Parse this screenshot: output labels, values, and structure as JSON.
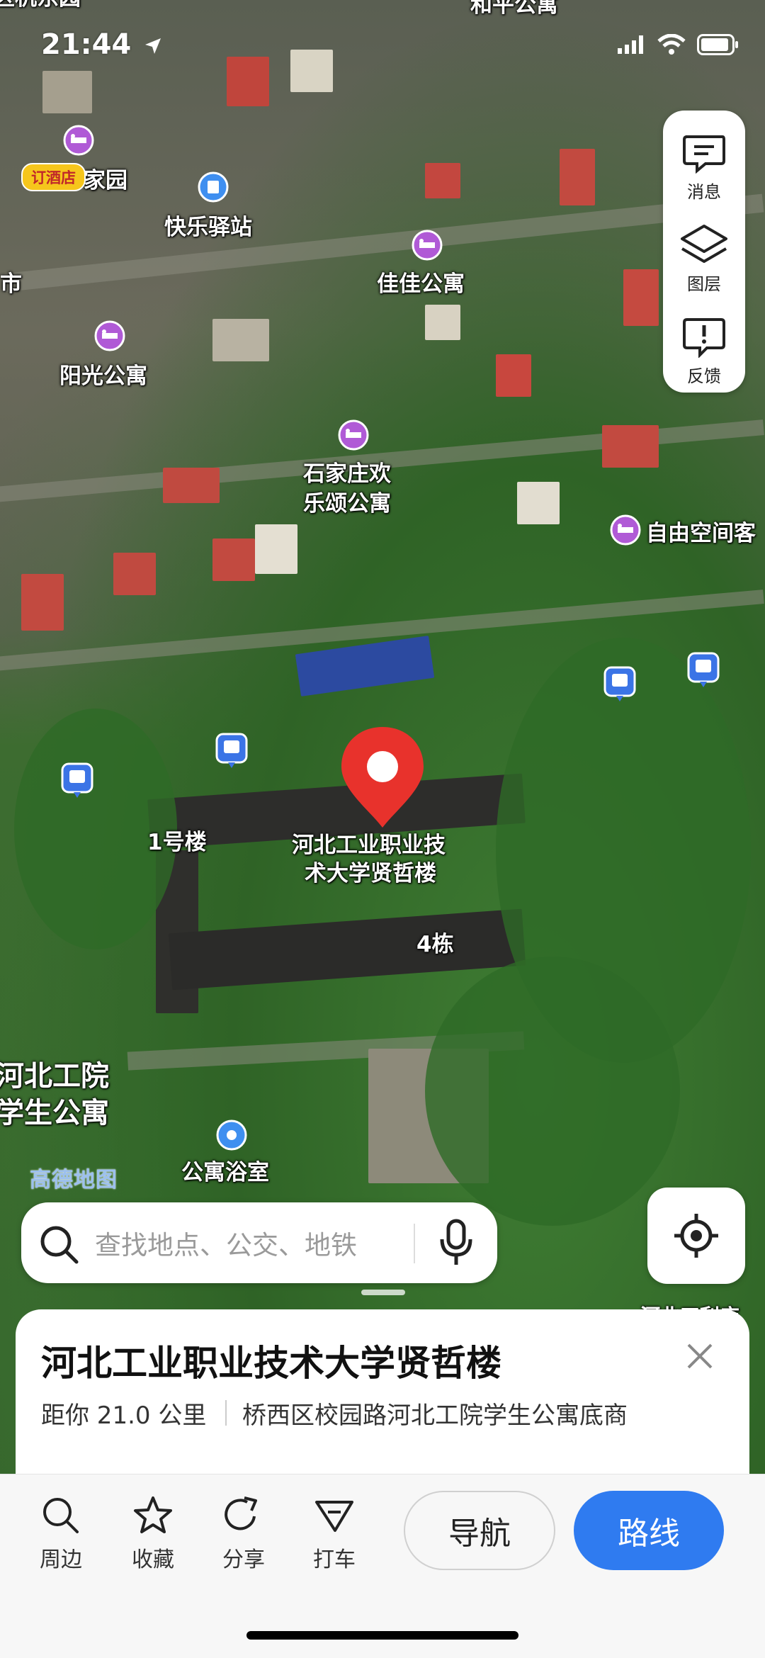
{
  "status_bar": {
    "time": "21:44"
  },
  "side_panel": {
    "items": [
      {
        "label": "消息",
        "icon": "message-icon"
      },
      {
        "label": "图层",
        "icon": "layers-icon"
      },
      {
        "label": "反馈",
        "icon": "feedback-icon"
      }
    ]
  },
  "map": {
    "labels": {
      "top_partial_left": "区机东园",
      "top_partial_right": "和平公寓",
      "left_edge": "市",
      "hotel_garden": "家园",
      "happy_inn": "快乐驿站",
      "jiajia": "佳佳公寓",
      "sunshine": "阳光公寓",
      "shijiazhuang_line1": "石家庄欢",
      "shijiazhuang_line2": "乐颂公寓",
      "freedom": "自由空间客",
      "building1": "1号楼",
      "target_line1": "河北工业职业技",
      "target_line2": "术大学贤哲楼",
      "building4": "4栋",
      "hebei_apt_line1": "河北工院",
      "hebei_apt_line2": "学生公寓",
      "bathhouse": "公寓浴室",
      "bottom_right_partial": "河北工利店"
    },
    "hotel_badge": "订酒店",
    "logo": "高德地图",
    "colors": {
      "pin_red": "#e8322c",
      "poi_purple": "#b05ad6",
      "bus_blue": "#3b74e6"
    }
  },
  "search": {
    "placeholder": "查找地点、公交、地铁"
  },
  "place": {
    "title": "河北工业职业技术大学贤哲楼",
    "distance": "距你 21.0 公里",
    "address": "桥西区校园路河北工院学生公寓底商"
  },
  "actions": {
    "nearby": "周边",
    "favorite": "收藏",
    "share": "分享",
    "taxi": "打车",
    "navigate": "导航",
    "route": "路线"
  },
  "accent_color": "#2f7bf0"
}
